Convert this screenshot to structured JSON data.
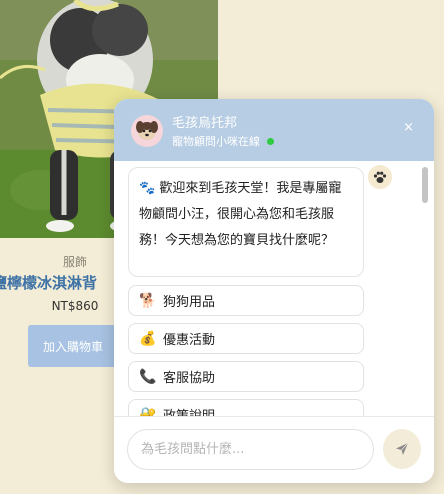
{
  "product": {
    "category": "服飾",
    "name": "鹽檸檬冰淇淋背",
    "price": "NT$860",
    "add_to_cart": "加入購物車"
  },
  "chat": {
    "title": "毛孩烏托邦",
    "status": "寵物顧問小咪在線",
    "close_glyph": "×",
    "header_avatar_icon": "puppy-face-icon",
    "bot_avatar_icon": "paw-icon",
    "welcome_emoji": "🐾",
    "welcome_message": "歡迎來到毛孩天堂！我是專屬寵物顧問小汪，很開心為您和毛孩服務！今天想為您的寶貝找什麼呢？",
    "options": [
      {
        "emoji": "🐕",
        "label": "狗狗用品"
      },
      {
        "emoji": "💰",
        "label": "優惠活動"
      },
      {
        "emoji": "📞",
        "label": "客服協助"
      },
      {
        "emoji": "🔐",
        "label": "政策說明"
      }
    ],
    "input_placeholder": "為毛孩問點什麼...",
    "send_icon": "paper-plane-icon"
  },
  "colors": {
    "page_background": "#f3ecd6",
    "header_background": "#b7cde3",
    "accent_blue": "#3f73a6",
    "button_blue": "#a7c2e2",
    "online_green": "#2ecc40"
  }
}
